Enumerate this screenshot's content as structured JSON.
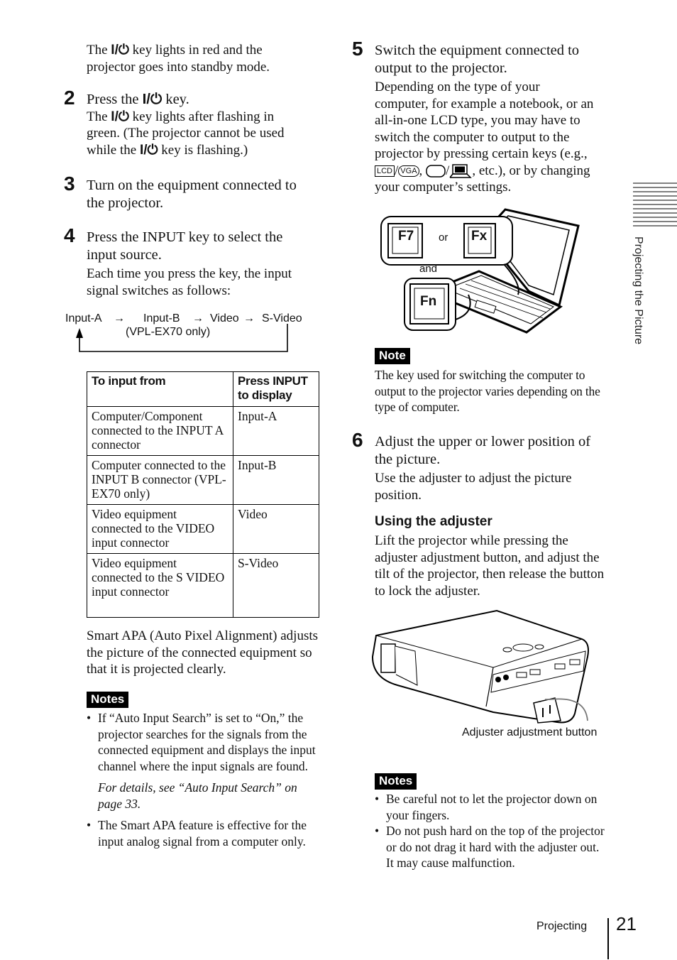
{
  "left_column": {
    "intro_line1_pre": "The ",
    "power_key": "I/⏻",
    "intro_line1_post": " key lights in red and the",
    "intro_line2": "projector goes into standby mode.",
    "steps": [
      {
        "number": "2",
        "title_pre": "Press the ",
        "title_post": " key.",
        "body_l1_pre": "The ",
        "body_l1_post": " key lights after flashing in",
        "body_l2": "green. (The projector cannot be used",
        "body_l3_pre": "while the ",
        "body_l3_post": " key is flashing.)"
      },
      {
        "number": "3",
        "title_l1": "Turn on the equipment connected to",
        "title_l2": "the projector."
      },
      {
        "number": "4",
        "title_l1": "Press the INPUT key to select the",
        "title_l2": "input source.",
        "body_l1": "Each time you press the key, the input",
        "body_l2": "signal switches as follows:"
      }
    ],
    "flow": {
      "items": [
        "Input-A",
        "Input-B",
        "Video",
        "S-Video"
      ],
      "arrow": "→",
      "note": "(VPL-EX70 only)"
    },
    "table": {
      "headers": [
        "To input from",
        "Press INPUT to display"
      ],
      "rows": [
        {
          "from": "Computer/Component connected to the INPUT A connector",
          "display": "Input-A"
        },
        {
          "from": "Computer connected to the INPUT B connector (VPL-EX70 only)",
          "display": "Input-B"
        },
        {
          "from": "Video equipment connected to the VIDEO input connector",
          "display": "Video"
        },
        {
          "from": "Video equipment connected to the S VIDEO input connector",
          "display": "S-Video"
        }
      ]
    },
    "smart_apa": "Smart APA (Auto Pixel Alignment) adjusts the picture of the connected equipment so that it is projected clearly.",
    "notes": {
      "label": "Notes",
      "items": [
        "If “Auto Input Search” is set to “On,” the projector searches for the signals from the connected equipment and displays the input channel where the input signals are found.",
        "The Smart APA feature is effective for the input analog signal from a computer only."
      ],
      "reference": "For details, see “Auto Input Search” on page 33."
    }
  },
  "right_column": {
    "step5": {
      "number": "5",
      "title_l1": "Switch the equipment connected to",
      "title_l2": "output to the projector.",
      "body": [
        "Depending on the type of your",
        "computer, for example a notebook, or an",
        "all-in-one LCD type, you may have to",
        "switch the computer to output to the",
        "projector by pressing certain keys (e.g.,"
      ],
      "keys_line_post": ", etc.), or by changing",
      "key_lcd": "LCD",
      "key_vga": "VGA",
      "last_line": "your computer’s settings."
    },
    "illustration_laptop": {
      "key1": "F7",
      "or": "or",
      "key2": "Fx",
      "and": "and",
      "key3": "Fn"
    },
    "note": {
      "label": "Note",
      "text": "The key used for switching the computer to output to the projector varies depending on the type of computer."
    },
    "step6": {
      "number": "6",
      "title_l1": "Adjust the upper or lower position of",
      "title_l2": "the picture.",
      "body": "Use the adjuster to adjust the picture position."
    },
    "adjuster": {
      "heading": "Using the adjuster",
      "body": "Lift the projector while pressing the adjuster adjustment button, and adjust the tilt of the projector, then release the button to lock the adjuster.",
      "caption": "Adjuster adjustment button"
    },
    "notes": {
      "label": "Notes",
      "items": [
        "Be careful not to let the projector down on your fingers.",
        "Do not push hard on the top of the projector or do not drag it hard with the adjuster out. It may cause malfunction."
      ]
    }
  },
  "side_tab": {
    "label": "Projecting the Picture"
  },
  "footer": {
    "section": "Projecting",
    "page_number": "21"
  }
}
